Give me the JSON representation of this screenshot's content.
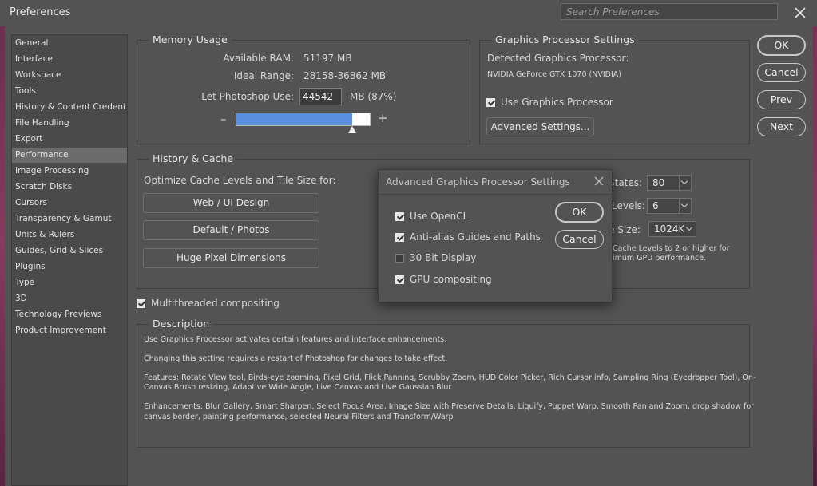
{
  "window": {
    "title": "Preferences",
    "search_placeholder": "Search Preferences"
  },
  "sidebar": {
    "items": [
      {
        "label": "General"
      },
      {
        "label": "Interface"
      },
      {
        "label": "Workspace"
      },
      {
        "label": "Tools"
      },
      {
        "label": "History & Content Credentials"
      },
      {
        "label": "File Handling"
      },
      {
        "label": "Export"
      },
      {
        "label": "Performance",
        "selected": true
      },
      {
        "label": "Image Processing"
      },
      {
        "label": "Scratch Disks"
      },
      {
        "label": "Cursors"
      },
      {
        "label": "Transparency & Gamut"
      },
      {
        "label": "Units & Rulers"
      },
      {
        "label": "Guides, Grid & Slices"
      },
      {
        "label": "Plugins"
      },
      {
        "label": "Type"
      },
      {
        "label": "3D"
      },
      {
        "label": "Technology Previews"
      },
      {
        "label": "Product Improvement"
      }
    ]
  },
  "memory": {
    "title": "Memory Usage",
    "available_label": "Available RAM:",
    "available_value": "51197 MB",
    "ideal_label": "Ideal Range:",
    "ideal_value": "28158-36862 MB",
    "use_label": "Let Photoshop Use:",
    "use_value": "44542",
    "use_suffix": "MB (87%)",
    "minus": "–",
    "plus": "+",
    "slider_fraction": 0.87
  },
  "gpu": {
    "title": "Graphics Processor Settings",
    "detected_label": "Detected Graphics Processor:",
    "gpu_name": "NVIDIA GeForce GTX 1070 (NVIDIA)",
    "use_label": "Use Graphics Processor",
    "use_checked": true,
    "advanced_button": "Advanced Settings..."
  },
  "history": {
    "title": "History & Cache",
    "optimize_label": "Optimize Cache Levels and Tile Size for:",
    "buttons": [
      "Web / UI Design",
      "Default / Photos",
      "Huge Pixel Dimensions"
    ],
    "states_label": "States:",
    "states_value": "80",
    "levels_label": "Levels:",
    "levels_value": "6",
    "tile_label": "e Size:",
    "tile_value": "1024K",
    "note_line1": "Cache Levels to 2 or higher for",
    "note_line2": "imum GPU performance."
  },
  "multithreaded": {
    "label": "Multithreaded compositing",
    "checked": true
  },
  "description": {
    "title": "Description",
    "lines": [
      "Use Graphics Processor activates certain features and interface enhancements.",
      "Changing this setting requires a restart of Photoshop for changes to take effect.",
      "Features: Rotate View tool, Birds-eye zooming, Pixel Grid, Flick Panning, Scrubby Zoom, HUD Color Picker, Rich Cursor info, Sampling Ring (Eyedropper Tool), On-",
      "Canvas Brush resizing, Adaptive Wide Angle, Live Canvas and Live Gaussian Blur",
      "Enhancements: Blur Gallery, Smart Sharpen, Select Focus Area, Image Size with Preserve Details, Liquify, Puppet Warp, Smooth Pan and Zoom, drop shadow for",
      "canvas border, painting performance, selected Neural Filters and Transform/Warp"
    ]
  },
  "actions": {
    "ok": "OK",
    "cancel": "Cancel",
    "prev": "Prev",
    "next": "Next"
  },
  "modal": {
    "title": "Advanced Graphics Processor Settings",
    "options": [
      {
        "label": "Use OpenCL",
        "checked": true
      },
      {
        "label": "Anti-alias Guides and Paths",
        "checked": true
      },
      {
        "label": "30 Bit Display",
        "checked": false
      },
      {
        "label": "GPU compositing",
        "checked": true
      }
    ],
    "ok": "OK",
    "cancel": "Cancel"
  }
}
